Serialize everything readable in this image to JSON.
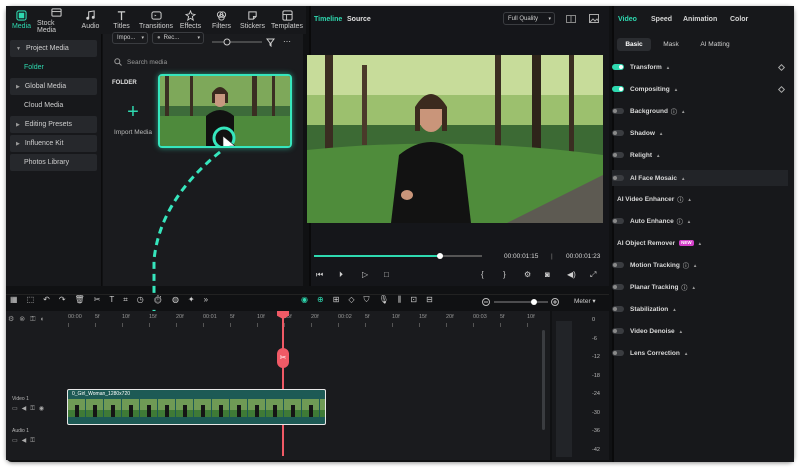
{
  "toolbar": {
    "tabs": [
      {
        "label": "Media",
        "icon": "media-icon",
        "active": true
      },
      {
        "label": "Stock Media",
        "icon": "stock-media-icon"
      },
      {
        "label": "Audio",
        "icon": "audio-icon"
      },
      {
        "label": "Titles",
        "icon": "titles-icon"
      },
      {
        "label": "Transitions",
        "icon": "transitions-icon"
      },
      {
        "label": "Effects",
        "icon": "effects-icon"
      },
      {
        "label": "Filters",
        "icon": "filters-icon"
      },
      {
        "label": "Stickers",
        "icon": "stickers-icon"
      },
      {
        "label": "Templates",
        "icon": "templates-icon"
      }
    ]
  },
  "leftnav": {
    "project_media": "Project Media",
    "folder": "Folder",
    "global_media": "Global Media",
    "cloud_media": "Cloud Media",
    "editing_presets": "Editing Presets",
    "influence_kit": "Influence Kit",
    "photos_library": "Photos Library"
  },
  "media": {
    "import_dropdown": "Impo...",
    "recent_dropdown": "Rec...",
    "search_placeholder": "Search media",
    "folder_label": "FOLDER",
    "import_label": "Import Media"
  },
  "preview": {
    "timeline_tab": "Timeline",
    "source_tab": "Source",
    "quality": "Full Quality",
    "current_time": "00:00:01:15",
    "total_time": "00:00:01:23",
    "progress_fraction": 0.75
  },
  "rpanel": {
    "tabs": [
      "Video",
      "Speed",
      "Animation",
      "Color"
    ],
    "subtabs": [
      "Basic",
      "Mask",
      "AI Matting"
    ],
    "rows": {
      "transform": "Transform",
      "compositing": "Compositing",
      "background": "Background",
      "shadow": "Shadow",
      "relight": "Relight",
      "ai_face_mosaic": "AI Face Mosaic",
      "ai_video_enhancer": "AI Video Enhancer",
      "auto_enhance": "Auto Enhance",
      "ai_object_remover": "AI Object Remover",
      "new_badge": "NEW",
      "motion_tracking": "Motion Tracking",
      "planar_tracking": "Planar Tracking",
      "stabilization": "Stabilization",
      "video_denoise": "Video Denoise",
      "lens_correction": "Lens Correction"
    }
  },
  "timeline": {
    "meter_label": "Meter",
    "ruler": [
      "00:00",
      "5f",
      "10f",
      "15f",
      "20f",
      "00:01",
      "5f",
      "10f",
      "15f",
      "20f",
      "00:02",
      "5f",
      "10f",
      "15f",
      "20f",
      "00:03",
      "5f",
      "10f"
    ],
    "video_track": "Video 1",
    "audio_track": "Audio 1",
    "clip_name": "0_Girl_Woman_1280x720",
    "meter_scale": [
      "0",
      "-6",
      "-12",
      "-18",
      "-24",
      "-30",
      "-36",
      "-42"
    ]
  },
  "colors": {
    "accent": "#2ed9b0",
    "playhead": "#f05a66",
    "badge": "#d33fc8"
  }
}
